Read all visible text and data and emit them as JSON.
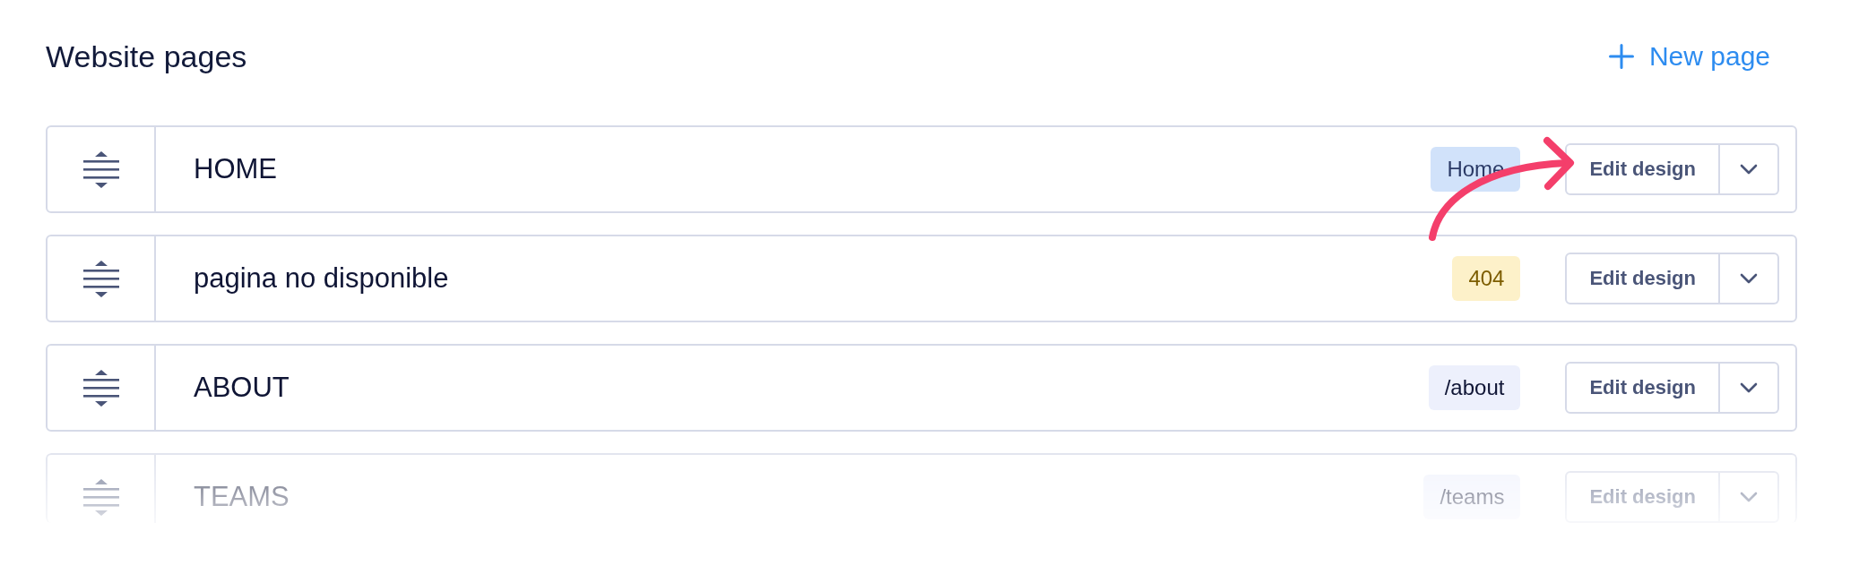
{
  "header": {
    "title": "Website pages",
    "new_page_button": "New page"
  },
  "rows": [
    {
      "name": "HOME",
      "badge": {
        "text": "Home",
        "kind": "home"
      },
      "edit_button": "Edit design",
      "faded": false
    },
    {
      "name": "pagina no disponible",
      "badge": {
        "text": "404",
        "kind": "error"
      },
      "edit_button": "Edit design",
      "faded": false
    },
    {
      "name": "ABOUT",
      "badge": {
        "text": "/about",
        "kind": "path"
      },
      "edit_button": "Edit design",
      "faded": false
    },
    {
      "name": "TEAMS",
      "badge": {
        "text": "/teams",
        "kind": "path"
      },
      "edit_button": "Edit design",
      "faded": true
    }
  ]
}
